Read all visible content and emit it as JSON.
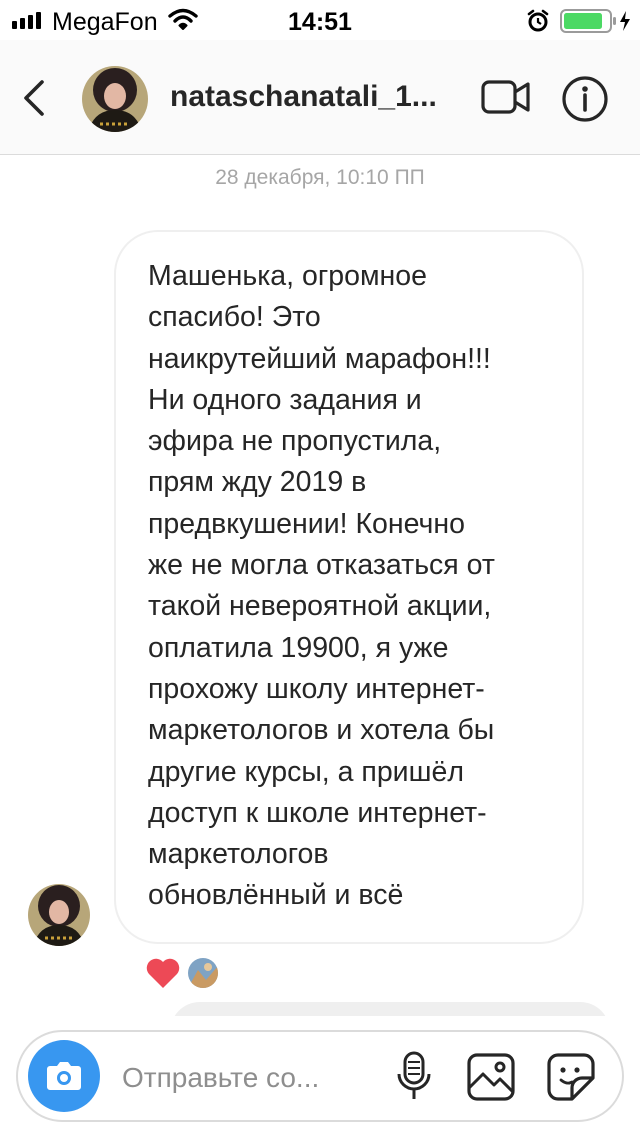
{
  "status_bar": {
    "carrier": "MegaFon",
    "time": "14:51",
    "icons": [
      "signal-icon",
      "wifi-icon",
      "alarm-icon",
      "battery-charging-icon"
    ],
    "battery_color": "#4cd964"
  },
  "header": {
    "username": "nataschanatali_1...",
    "icons": [
      "back-chevron-icon",
      "video-call-icon",
      "info-icon"
    ]
  },
  "thread": {
    "date_label": "28 декабря, 10:10 ПП",
    "message": {
      "text": "Машенька, огромное\nспасибо! Это\nнаикрутейший марафон!!!\nНи одного задания и\nэфира не пропустила,\nпрям жду 2019 в\nпредвкушении! Конечно\nже не могла отказаться от\nтакой невероятной акции,\nоплатила 19900, я уже\nпрохожу школу интернет-\nмаркетологов и хотела бы\nдругие курсы, а пришёл\nдоступ к школе интернет-\nмаркетологов\nобновлённый и всё"
    },
    "reactions": [
      "heart-icon"
    ],
    "heart_color": "#ed4956"
  },
  "composer": {
    "placeholder": "Отправьте со...",
    "accent_color": "#3897f0",
    "icons": [
      "camera-icon",
      "microphone-icon",
      "gallery-icon",
      "sticker-icon"
    ]
  }
}
